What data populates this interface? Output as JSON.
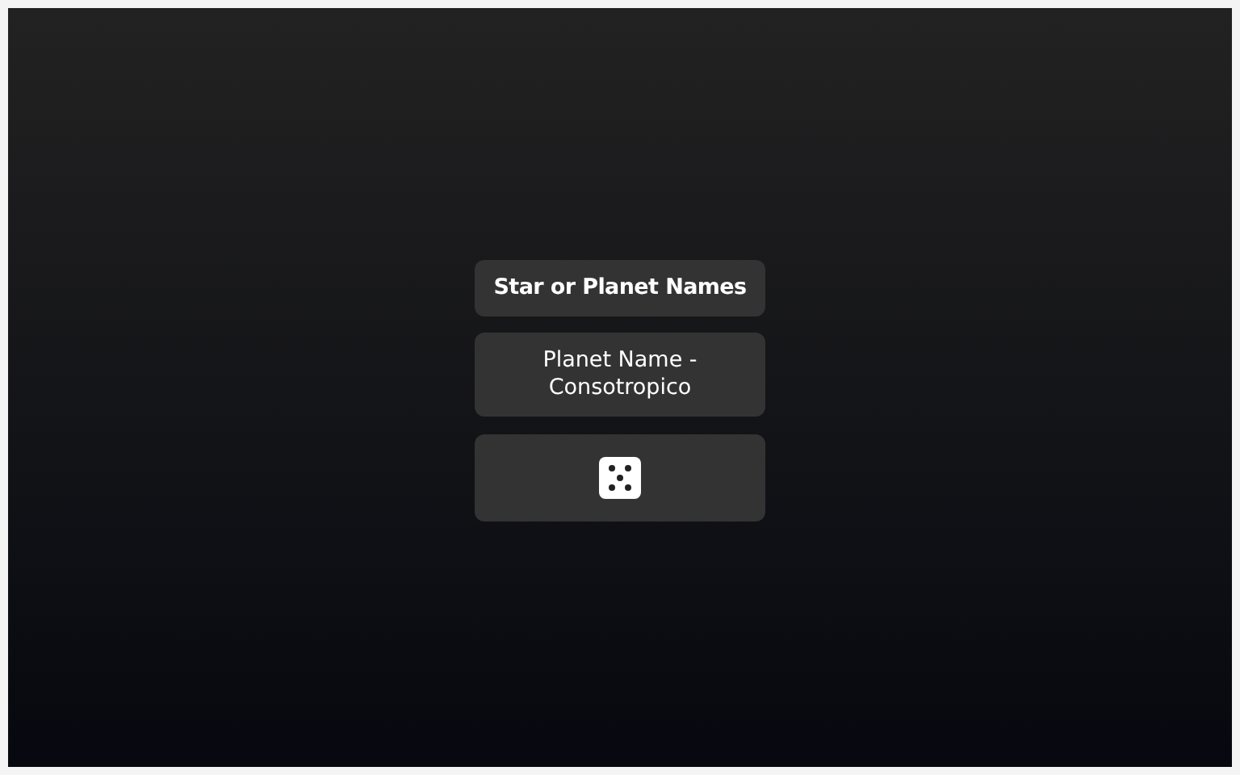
{
  "title": "Star or Planet Names",
  "result": "Planet Name - Consotropico"
}
